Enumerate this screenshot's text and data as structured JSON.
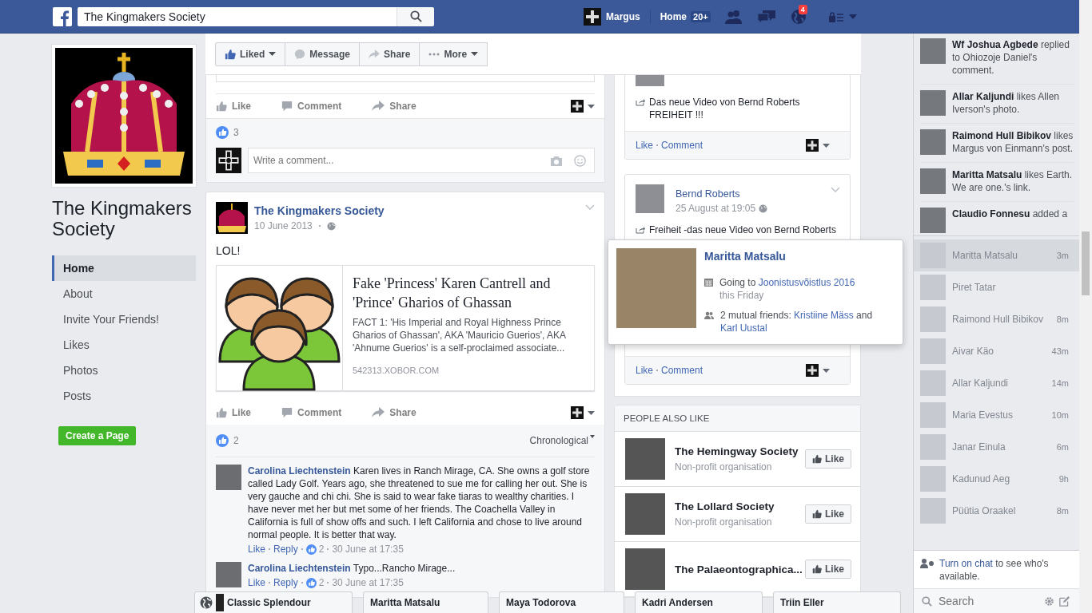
{
  "topbar": {
    "search": {
      "value": "The Kingmakers Society"
    },
    "user": "Margus",
    "home": {
      "label": "Home",
      "badge": "20+"
    },
    "notifications": "4"
  },
  "page": {
    "title": "The Kingmakers Society",
    "create_button": "Create a Page",
    "nav": [
      {
        "label": "Home",
        "selected": true
      },
      {
        "label": "About",
        "selected": false
      },
      {
        "label": "Invite Your Friends!",
        "selected": false
      },
      {
        "label": "Likes",
        "selected": false
      },
      {
        "label": "Photos",
        "selected": false
      },
      {
        "label": "Posts",
        "selected": false
      }
    ]
  },
  "page_actions": [
    {
      "kind": "liked",
      "label": "Liked",
      "dropdown": true
    },
    {
      "kind": "message",
      "label": "Message",
      "dropdown": false
    },
    {
      "kind": "share",
      "label": "Share",
      "dropdown": false
    },
    {
      "kind": "more",
      "label": "More",
      "dropdown": true
    }
  ],
  "previous_post": {
    "actions": [
      {
        "kind": "like",
        "label": "Like"
      },
      {
        "kind": "comment",
        "label": "Comment"
      },
      {
        "kind": "share",
        "label": "Share"
      }
    ],
    "likes": "3",
    "comment_field": {
      "placeholder": "Write a comment..."
    }
  },
  "post": {
    "author": "The Kingmakers Society",
    "date": "10 June 2013",
    "text": "LOL!",
    "link": {
      "title": "Fake 'Princess' Karen Cantrell and 'Prince' Gharios of Ghassan",
      "description": "FACT 1: 'His Imperial and Royal Highness Prince Gharios of Ghassan', AKA 'Mauricio Guerios', AKA 'Ahnume Guerios' is a self-proclaimed associate...",
      "domain": "542313.XOBOR.COM"
    },
    "actions": [
      {
        "kind": "like",
        "label": "Like"
      },
      {
        "kind": "comment",
        "label": "Comment"
      },
      {
        "kind": "share",
        "label": "Share"
      }
    ],
    "likes": "2",
    "sort": "Chronological",
    "comments": [
      {
        "author": "Carolina Liechtenstein",
        "text": "Karen lives in Ranch Mirage, CA. She owns a golf store called Lady Golf. Years ago, she threatened to sue me for calling her out. She is very gauche and chi chi. She is said to wear fake tiaras to wealthy charities. I have never met her but met some of her friends. The Coachella Valley in California is full of show offs and such. I left California and chose to live around normal people. It is better that way.",
        "actions": [
          "Like",
          "Reply"
        ],
        "likes": "2",
        "time": "30 June at 17:35"
      },
      {
        "author": "Carolina Liechtenstein",
        "text": "Typo...Rancho Mirage...",
        "actions": [
          "Like",
          "Reply"
        ],
        "likes": "2",
        "time": "30 June at 17:35"
      }
    ]
  },
  "visitor_posts": [
    {
      "text": "Das neue Video von Bernd Roberts\nFREIHEIT !!!",
      "footer": [
        "Like",
        "Comment"
      ]
    },
    {
      "author": "Bernd Roberts",
      "date": "25 August at 19:05",
      "text": "Freiheit -das neue Video von Bernd Roberts",
      "footer": [
        "Like",
        "Comment"
      ]
    }
  ],
  "hovercard": {
    "name": "Maritta Matsalu",
    "event": {
      "prefix": "Going to",
      "link": "Joonistusvõistlus 2016",
      "when": "this Friday"
    },
    "mutual": {
      "prefix": "2 mutual friends:",
      "friends": [
        "Kristiine Mäss",
        "Karl Uustal"
      ],
      "joiner": "and"
    }
  },
  "people_also_like": {
    "title": "PEOPLE ALSO LIKE",
    "pages": [
      {
        "name": "The Hemingway Society",
        "category": "Non-profit organisation",
        "button": "Like"
      },
      {
        "name": "The Lollard Society",
        "category": "Non-profit organisation",
        "button": "Like"
      },
      {
        "name": "The Palaeontographica...",
        "button": "Like"
      }
    ]
  },
  "ticker": [
    "**Wf Joshua Agbede** replied to Ohiozoje Daniel's comment.",
    "**Allar Kaljundi** likes Allen Iverson's photo.",
    "**Raimond Hull Bibikov** likes Margus von Einmann's post.",
    "**Maritta Matsalu** likes Earth. We are one.'s link.",
    "**Claudio Fonnesu** added a"
  ],
  "chat": {
    "contacts": [
      {
        "name": "Maritta Matsalu",
        "time": "3m",
        "selected": true
      },
      {
        "name": "Piret Tatar",
        "selected": false
      },
      {
        "name": "Raimond Hull Bibikov",
        "time": "8m",
        "selected": false
      },
      {
        "name": "Aivar Käo",
        "time": "43m",
        "selected": false
      },
      {
        "name": "Allar Kaljundi",
        "time": "14m",
        "selected": false
      },
      {
        "name": "Maria Evestus",
        "time": "10m",
        "selected": false
      },
      {
        "name": "Janar Einula",
        "time": "6m",
        "selected": false
      },
      {
        "name": "Kadunud Aeg",
        "time": "9h",
        "selected": false
      },
      {
        "name": "Püütia Oraakel",
        "time": "8m",
        "selected": false
      }
    ],
    "notice": {
      "link": "Turn on chat",
      "text": "to see who's available."
    },
    "search": {
      "placeholder": "Search"
    }
  },
  "chat_tabs": [
    {
      "kind": "page",
      "name": "Classic Splendour"
    },
    {
      "kind": "person",
      "name": "Maritta Matsalu"
    },
    {
      "kind": "person",
      "name": "Maya Todorova"
    },
    {
      "kind": "person",
      "name": "Kadri Andersen"
    },
    {
      "kind": "person",
      "name": "Triin Eller"
    }
  ]
}
